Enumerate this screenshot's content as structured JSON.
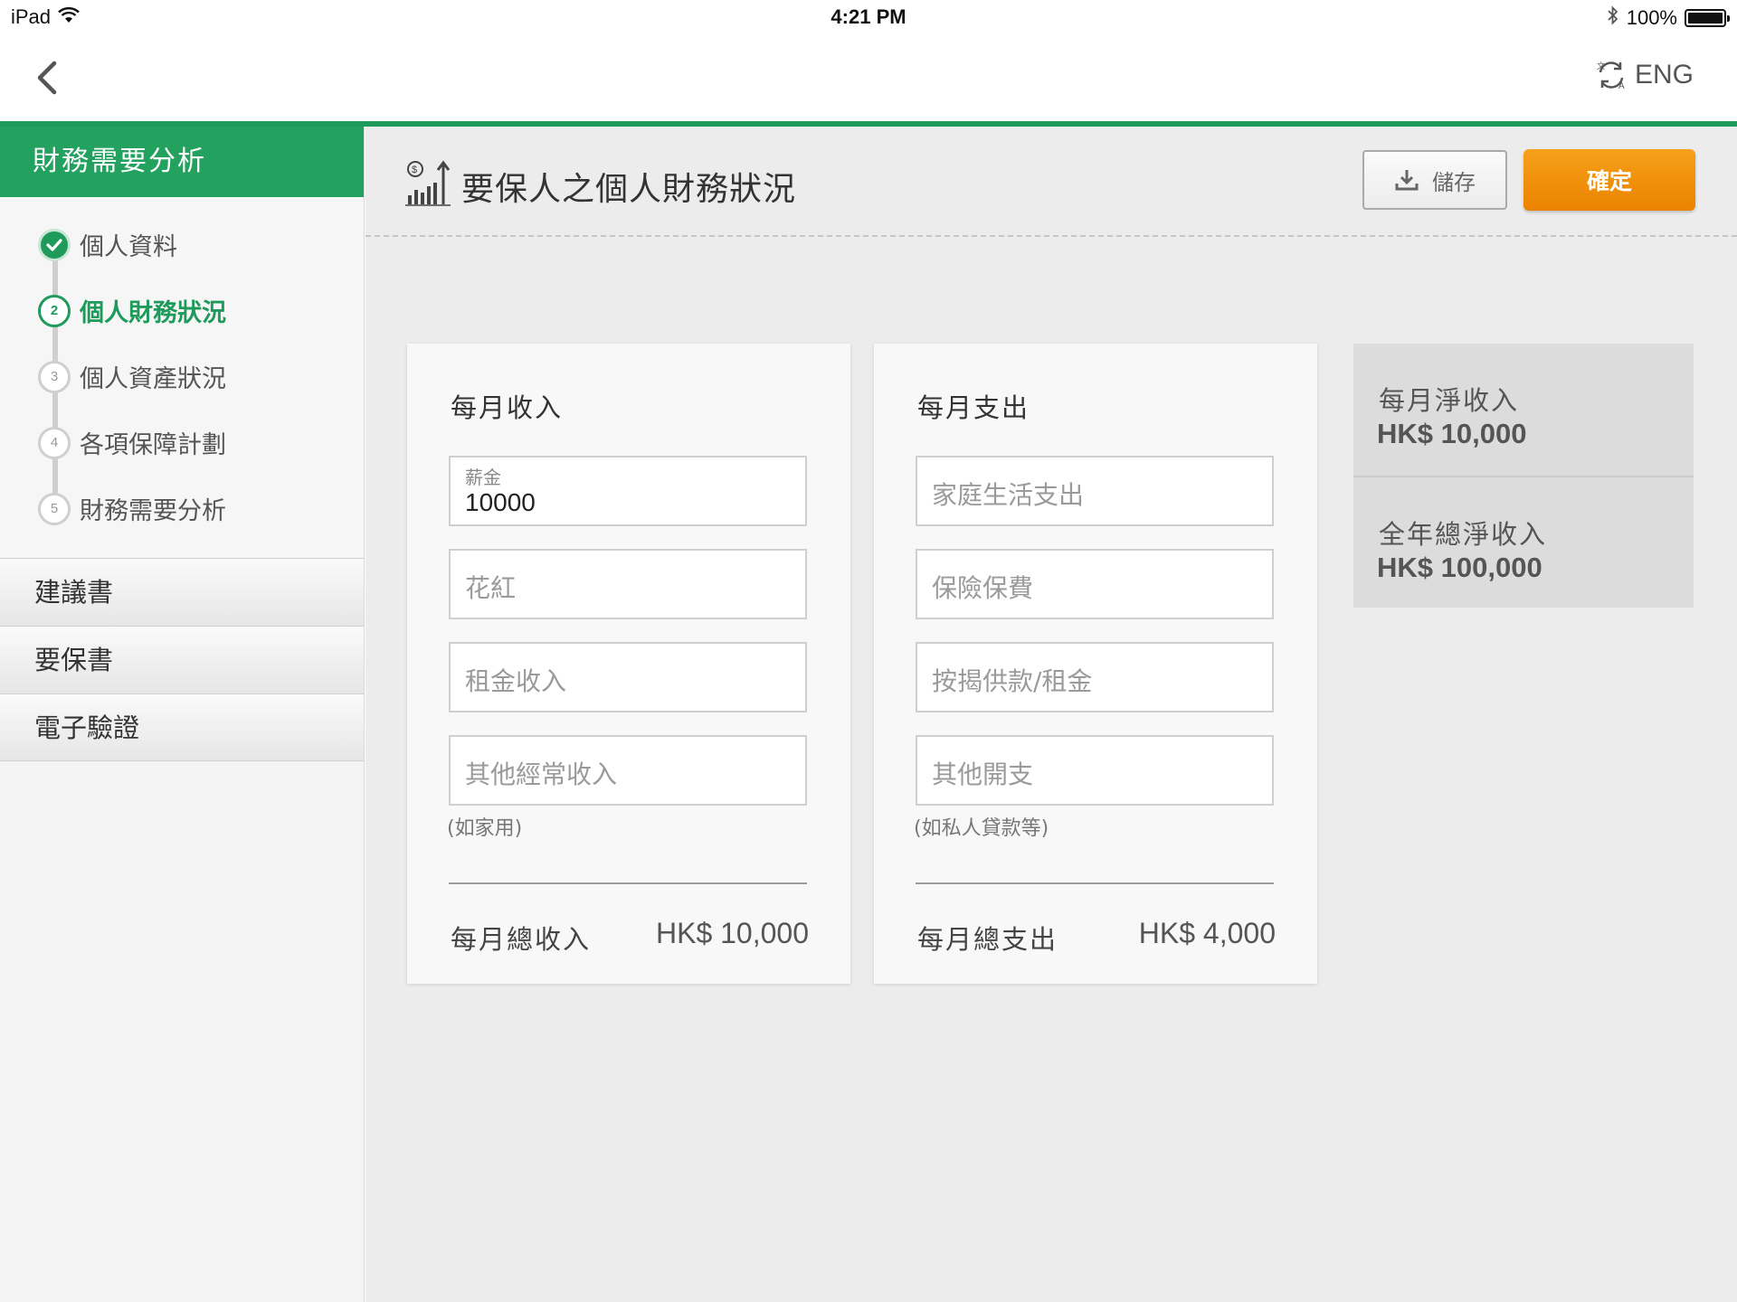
{
  "status_bar": {
    "device": "iPad",
    "time": "4:21 PM",
    "battery": "100%"
  },
  "nav": {
    "lang_label": "ENG"
  },
  "sidebar": {
    "title": "財務需要分析",
    "steps": [
      {
        "number": "1",
        "label": "個人資料",
        "state": "done"
      },
      {
        "number": "2",
        "label": "個人財務狀況",
        "state": "active"
      },
      {
        "number": "3",
        "label": "個人資產狀況",
        "state": "pending"
      },
      {
        "number": "4",
        "label": "各項保障計劃",
        "state": "pending"
      },
      {
        "number": "5",
        "label": "財務需要分析",
        "state": "pending"
      }
    ],
    "sections": [
      "建議書",
      "要保書",
      "電子驗證"
    ]
  },
  "header": {
    "title": "要保人之個人財務狀況",
    "save_label": "儲存",
    "confirm_label": "確定"
  },
  "income": {
    "title": "每月收入",
    "fields": [
      {
        "label": "薪金",
        "value": "10000",
        "placeholder": "薪金"
      },
      {
        "placeholder": "花紅"
      },
      {
        "placeholder": "租金收入"
      },
      {
        "placeholder": "其他經常收入"
      }
    ],
    "note": "(如家用)",
    "total_label": "每月總收入",
    "total_value": "HK$ 10,000"
  },
  "expense": {
    "title": "每月支出",
    "fields": [
      {
        "placeholder": "家庭生活支出"
      },
      {
        "placeholder": "保險保費"
      },
      {
        "placeholder": "按揭供款/租金"
      },
      {
        "placeholder": "其他開支"
      }
    ],
    "note": "(如私人貸款等)",
    "total_label": "每月總支出",
    "total_value": "HK$ 4,000"
  },
  "summary": [
    {
      "label": "每月淨收入",
      "value": "HK$ 10,000"
    },
    {
      "label": "全年總淨收入",
      "value": "HK$ 100,000"
    }
  ],
  "colors": {
    "brand_green": "#1e9b5b",
    "confirm_orange": "#f08c0a"
  },
  "icons": [
    "wifi-icon",
    "bluetooth-icon",
    "battery-icon",
    "back-chevron-icon",
    "language-switch-icon",
    "check-icon",
    "finance-chart-icon",
    "download-icon"
  ]
}
